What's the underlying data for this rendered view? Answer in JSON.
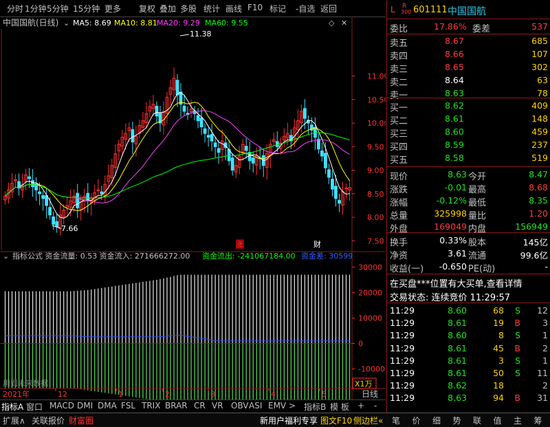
{
  "toolbar": {
    "items": [
      "分时",
      "1分钟",
      "5分钟",
      "15分钟",
      "更多",
      "复权",
      "叠加",
      "多股",
      "统计",
      "画线",
      "F10",
      "标记",
      "-自选",
      "返回"
    ]
  },
  "stock": {
    "code": "601111",
    "name": "中国国航",
    "l_mark": "L",
    "r_mark": "R",
    "r_sub": "300"
  },
  "kline": {
    "header_name": "中国国航(日线)",
    "ma5_label": "MA5: 8.69",
    "ma10_label": "MA10: 8.81",
    "ma20_label": "MA20: 9.29",
    "ma60_label": "MA60: 9.55",
    "colors": {
      "ma5": "#ffffff",
      "ma10": "#ffff00",
      "ma20": "#ff40ff",
      "ma60": "#00ff00",
      "up": "#ff3030",
      "down": "#40e0ff"
    },
    "high_label": "11.38",
    "low_label": "7.66",
    "marker_zhang": "涨",
    "marker_cai": "财"
  },
  "indicator": {
    "header": "指标公式 资金流量: 0.53 资金流入: 271666272.00",
    "outflow": "资金流出: -241067184.00",
    "diff": "资金差: 30599",
    "footer_text": "用到未来数据",
    "unit": "X1万"
  },
  "date_axis": {
    "labels": [
      "2021年",
      "12",
      "1",
      "2",
      "3",
      "4",
      "5"
    ],
    "period": "日线"
  },
  "tabs": [
    "指标A",
    "窗口",
    "MACD",
    "DMI",
    "DMA",
    "FSL",
    "TRIX",
    "BRAR",
    "CR",
    "VR",
    "OBV",
    "ASI",
    "EMV",
    ">",
    "指标B",
    "模 板",
    "+",
    "-"
  ],
  "bottom": {
    "left": [
      "扩展∧",
      "关联报价",
      "财富圈"
    ],
    "mid": "新用户福利专享",
    "f10": "图文F10",
    "side": "侧边栏«",
    "right_tabs": [
      "笔",
      "价",
      "细",
      "势",
      "联",
      "值",
      "主",
      "筹"
    ]
  },
  "orderbook": {
    "wb_label": "委比",
    "wb_value": "17.86%",
    "wc_label": "委差",
    "wc_value": "537",
    "sell": [
      {
        "label": "卖五",
        "price": "8.67",
        "vol": "685"
      },
      {
        "label": "卖四",
        "price": "8.66",
        "vol": "107"
      },
      {
        "label": "卖三",
        "price": "8.65",
        "vol": "302"
      },
      {
        "label": "卖二",
        "price": "8.64",
        "vol": "63"
      },
      {
        "label": "卖一",
        "price": "8.63",
        "vol": "78"
      }
    ],
    "buy": [
      {
        "label": "买一",
        "price": "8.62",
        "vol": "409"
      },
      {
        "label": "买二",
        "price": "8.61",
        "vol": "148"
      },
      {
        "label": "买三",
        "price": "8.60",
        "vol": "459"
      },
      {
        "label": "买四",
        "price": "8.59",
        "vol": "237"
      },
      {
        "label": "买五",
        "price": "8.58",
        "vol": "519"
      }
    ]
  },
  "quote": {
    "rows": [
      {
        "l1": "现价",
        "v1": "8.63",
        "l2": "今开",
        "v2": "8.47"
      },
      {
        "l1": "涨跌",
        "v1": "-0.01",
        "l2": "最高",
        "v2": "8.68"
      },
      {
        "l1": "涨幅",
        "v1": "-0.12%",
        "l2": "最低",
        "v2": "8.35"
      },
      {
        "l1": "总量",
        "v1": "325998",
        "l2": "量比",
        "v2": "1.20"
      },
      {
        "l1": "外盘",
        "v1": "169049",
        "l2": "内盘",
        "v2": "156949"
      }
    ],
    "rows2": [
      {
        "l1": "换手",
        "v1": "0.33%",
        "l2": "股本",
        "v2": "145亿"
      },
      {
        "l1": "净资",
        "v1": "3.61",
        "l2": "流通",
        "v2": "99.6亿"
      },
      {
        "l1": "收益(一)",
        "v1": "-0.650",
        "l2": "PE(动)",
        "v2": "-"
      }
    ],
    "notice": "在买盘***位置有大买单,查看详情",
    "status": "交易状态: 连续竞价  11:29:57"
  },
  "ticks": [
    {
      "time": "11:29",
      "price": "8.60",
      "vol": "68",
      "side": "S",
      "n": "12"
    },
    {
      "time": "11:29",
      "price": "8.61",
      "vol": "19",
      "side": "B",
      "n": "3"
    },
    {
      "time": "11:29",
      "price": "8.60",
      "vol": "8",
      "side": "S",
      "n": "1"
    },
    {
      "time": "11:29",
      "price": "8.61",
      "vol": "45",
      "side": "B",
      "n": "2"
    },
    {
      "time": "11:29",
      "price": "8.61",
      "vol": "3",
      "side": "S",
      "n": "1"
    },
    {
      "time": "11:29",
      "price": "8.61",
      "vol": "50",
      "side": "S",
      "n": "11"
    },
    {
      "time": "11:29",
      "price": "8.62",
      "vol": "18",
      "side": "",
      "n": "2"
    },
    {
      "time": "11:29",
      "price": "8.63",
      "vol": "94",
      "side": "B",
      "n": "31"
    }
  ],
  "chart_data": [
    {
      "type": "candlestick",
      "title": "中国国航(日线)",
      "ylim": [
        7.3,
        12.0
      ],
      "y_ticks": [
        7.5,
        8.0,
        8.5,
        9.0,
        9.5,
        10.0,
        10.5,
        11.0
      ],
      "x_labels": [
        "2021年",
        "12",
        "1",
        "2",
        "3",
        "4",
        "5"
      ],
      "close": [
        8.45,
        8.58,
        8.72,
        8.8,
        8.62,
        8.7,
        8.9,
        8.82,
        8.65,
        8.58,
        8.5,
        8.4,
        8.25,
        8.05,
        7.85,
        7.8,
        8.05,
        8.15,
        8.25,
        8.35,
        8.45,
        8.2,
        8.38,
        8.45,
        8.35,
        8.4,
        8.52,
        8.58,
        8.5,
        8.7,
        8.88,
        9.1,
        9.35,
        9.55,
        9.7,
        9.78,
        9.9,
        9.6,
        9.72,
        9.95,
        10.05,
        10.2,
        10.35,
        10.4,
        10.15,
        10.0,
        10.25,
        10.55,
        10.75,
        10.95,
        10.6,
        10.4,
        10.25,
        10.18,
        10.3,
        10.2,
        10.05,
        9.92,
        9.78,
        9.7,
        9.62,
        9.5,
        9.38,
        9.62,
        9.48,
        9.2,
        9.0,
        9.1,
        9.3,
        9.55,
        9.42,
        9.2,
        9.15,
        9.3,
        9.25,
        9.1,
        9.35,
        9.55,
        9.65,
        9.5,
        9.58,
        9.72,
        9.78,
        9.62,
        9.9,
        10.05,
        10.25,
        10.1,
        10.0,
        9.85,
        9.7,
        9.45,
        9.3,
        9.05,
        8.85,
        8.6,
        8.4,
        8.3,
        8.55,
        8.62,
        8.63
      ],
      "ma_labels": [
        "MA5: 8.69",
        "MA10: 8.81",
        "MA20: 9.29",
        "MA60: 9.55"
      ],
      "annotations": [
        "11.38",
        "7.66"
      ]
    },
    {
      "type": "bar",
      "title": "指标公式",
      "ylim": [
        -22000,
        32000
      ],
      "y_ticks": [
        30000,
        20000,
        10000,
        0,
        -10000
      ],
      "unit": "X1万",
      "inflow": [
        20500,
        20500,
        20500,
        20500,
        20500,
        20500,
        20500,
        20500,
        20500,
        20500,
        20500,
        20500,
        20500,
        20500,
        20500,
        20500,
        20500,
        20500,
        20500,
        20500,
        20600,
        20700,
        20800,
        20900,
        21000,
        21200,
        21400,
        21600,
        21800,
        22000,
        22200,
        22400,
        22600,
        22800,
        23000,
        23200,
        23400,
        23600,
        23800,
        24000,
        24200,
        24400,
        24600,
        24800,
        25000,
        25300,
        25600,
        25900,
        26200,
        26500,
        26800,
        27000,
        27000,
        27000,
        27000,
        27000,
        27000,
        27000,
        27000,
        27000,
        27000,
        27000,
        27000,
        27000,
        27000,
        27000,
        27000,
        27000,
        27000,
        27000,
        27000,
        27000,
        27000,
        27000,
        27000,
        27000,
        27000,
        27000,
        27000,
        27000,
        27000,
        27000,
        27000,
        27000,
        27000,
        27000,
        27000,
        27000,
        27000,
        27000,
        27000,
        27000,
        27000,
        27000,
        27000,
        27000,
        27000,
        27000,
        27000,
        27000,
        27000
      ],
      "outflow": [
        -17500,
        -17500,
        -17500,
        -17500,
        -17500,
        -17500,
        -17500,
        -17500,
        -17500,
        -17500,
        -17500,
        -17500,
        -17500,
        -17500,
        -17500,
        -17500,
        -17500,
        -17500,
        -17500,
        -17500,
        -17600,
        -17800,
        -18000,
        -18200,
        -18400,
        -18600,
        -18800,
        -19000,
        -19200,
        -19400,
        -19600,
        -19800,
        -20000,
        -20200,
        -20400,
        -20600,
        -20800,
        -21000,
        -21200,
        -21400,
        -21600,
        -21800,
        -22000,
        -22200,
        -22400,
        -22600,
        -22800,
        -23000,
        -23200,
        -23400,
        -23600,
        -23800,
        -24000,
        -24200,
        -24400,
        -24600,
        -24800,
        -25000,
        -25200,
        -25400,
        -25600,
        -25800,
        -26000,
        -26000,
        -26000,
        -26000,
        -26000,
        -26000,
        -26000,
        -26000,
        -26000,
        -26000,
        -26000,
        -26000,
        -26000,
        -26000,
        -26000,
        -26000,
        -26000,
        -26000,
        -26000,
        -26000,
        -26000,
        -26000,
        -26000,
        -26000,
        -26000,
        -26000,
        -26000,
        -26000,
        -26000,
        -26000,
        -26000,
        -26000,
        -26000,
        -26000,
        -26000,
        -26000,
        -26000,
        -26000,
        -26000
      ]
    }
  ]
}
